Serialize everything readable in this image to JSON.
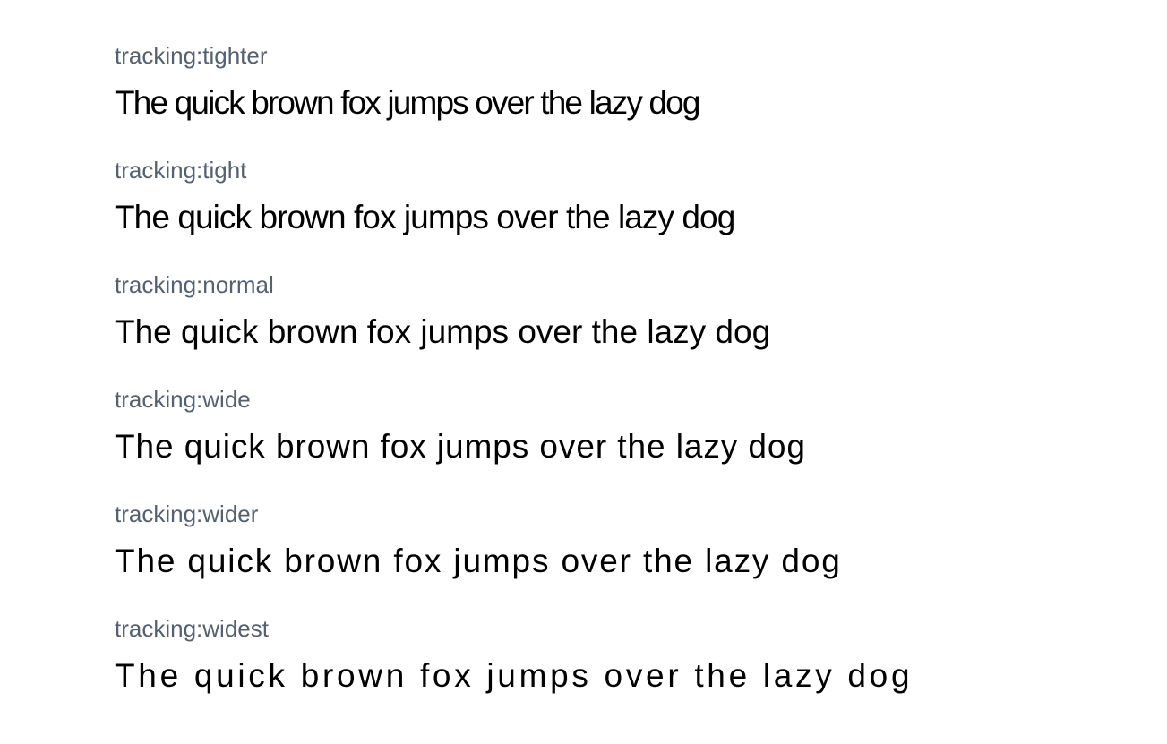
{
  "sample_text": "The quick brown fox jumps over the lazy dog",
  "label_color": "#56606f",
  "text_color": "#000000",
  "items": [
    {
      "label": "tracking:tighter"
    },
    {
      "label": "tracking:tight"
    },
    {
      "label": "tracking:normal"
    },
    {
      "label": "tracking:wide"
    },
    {
      "label": "tracking:wider"
    },
    {
      "label": "tracking:widest"
    }
  ]
}
